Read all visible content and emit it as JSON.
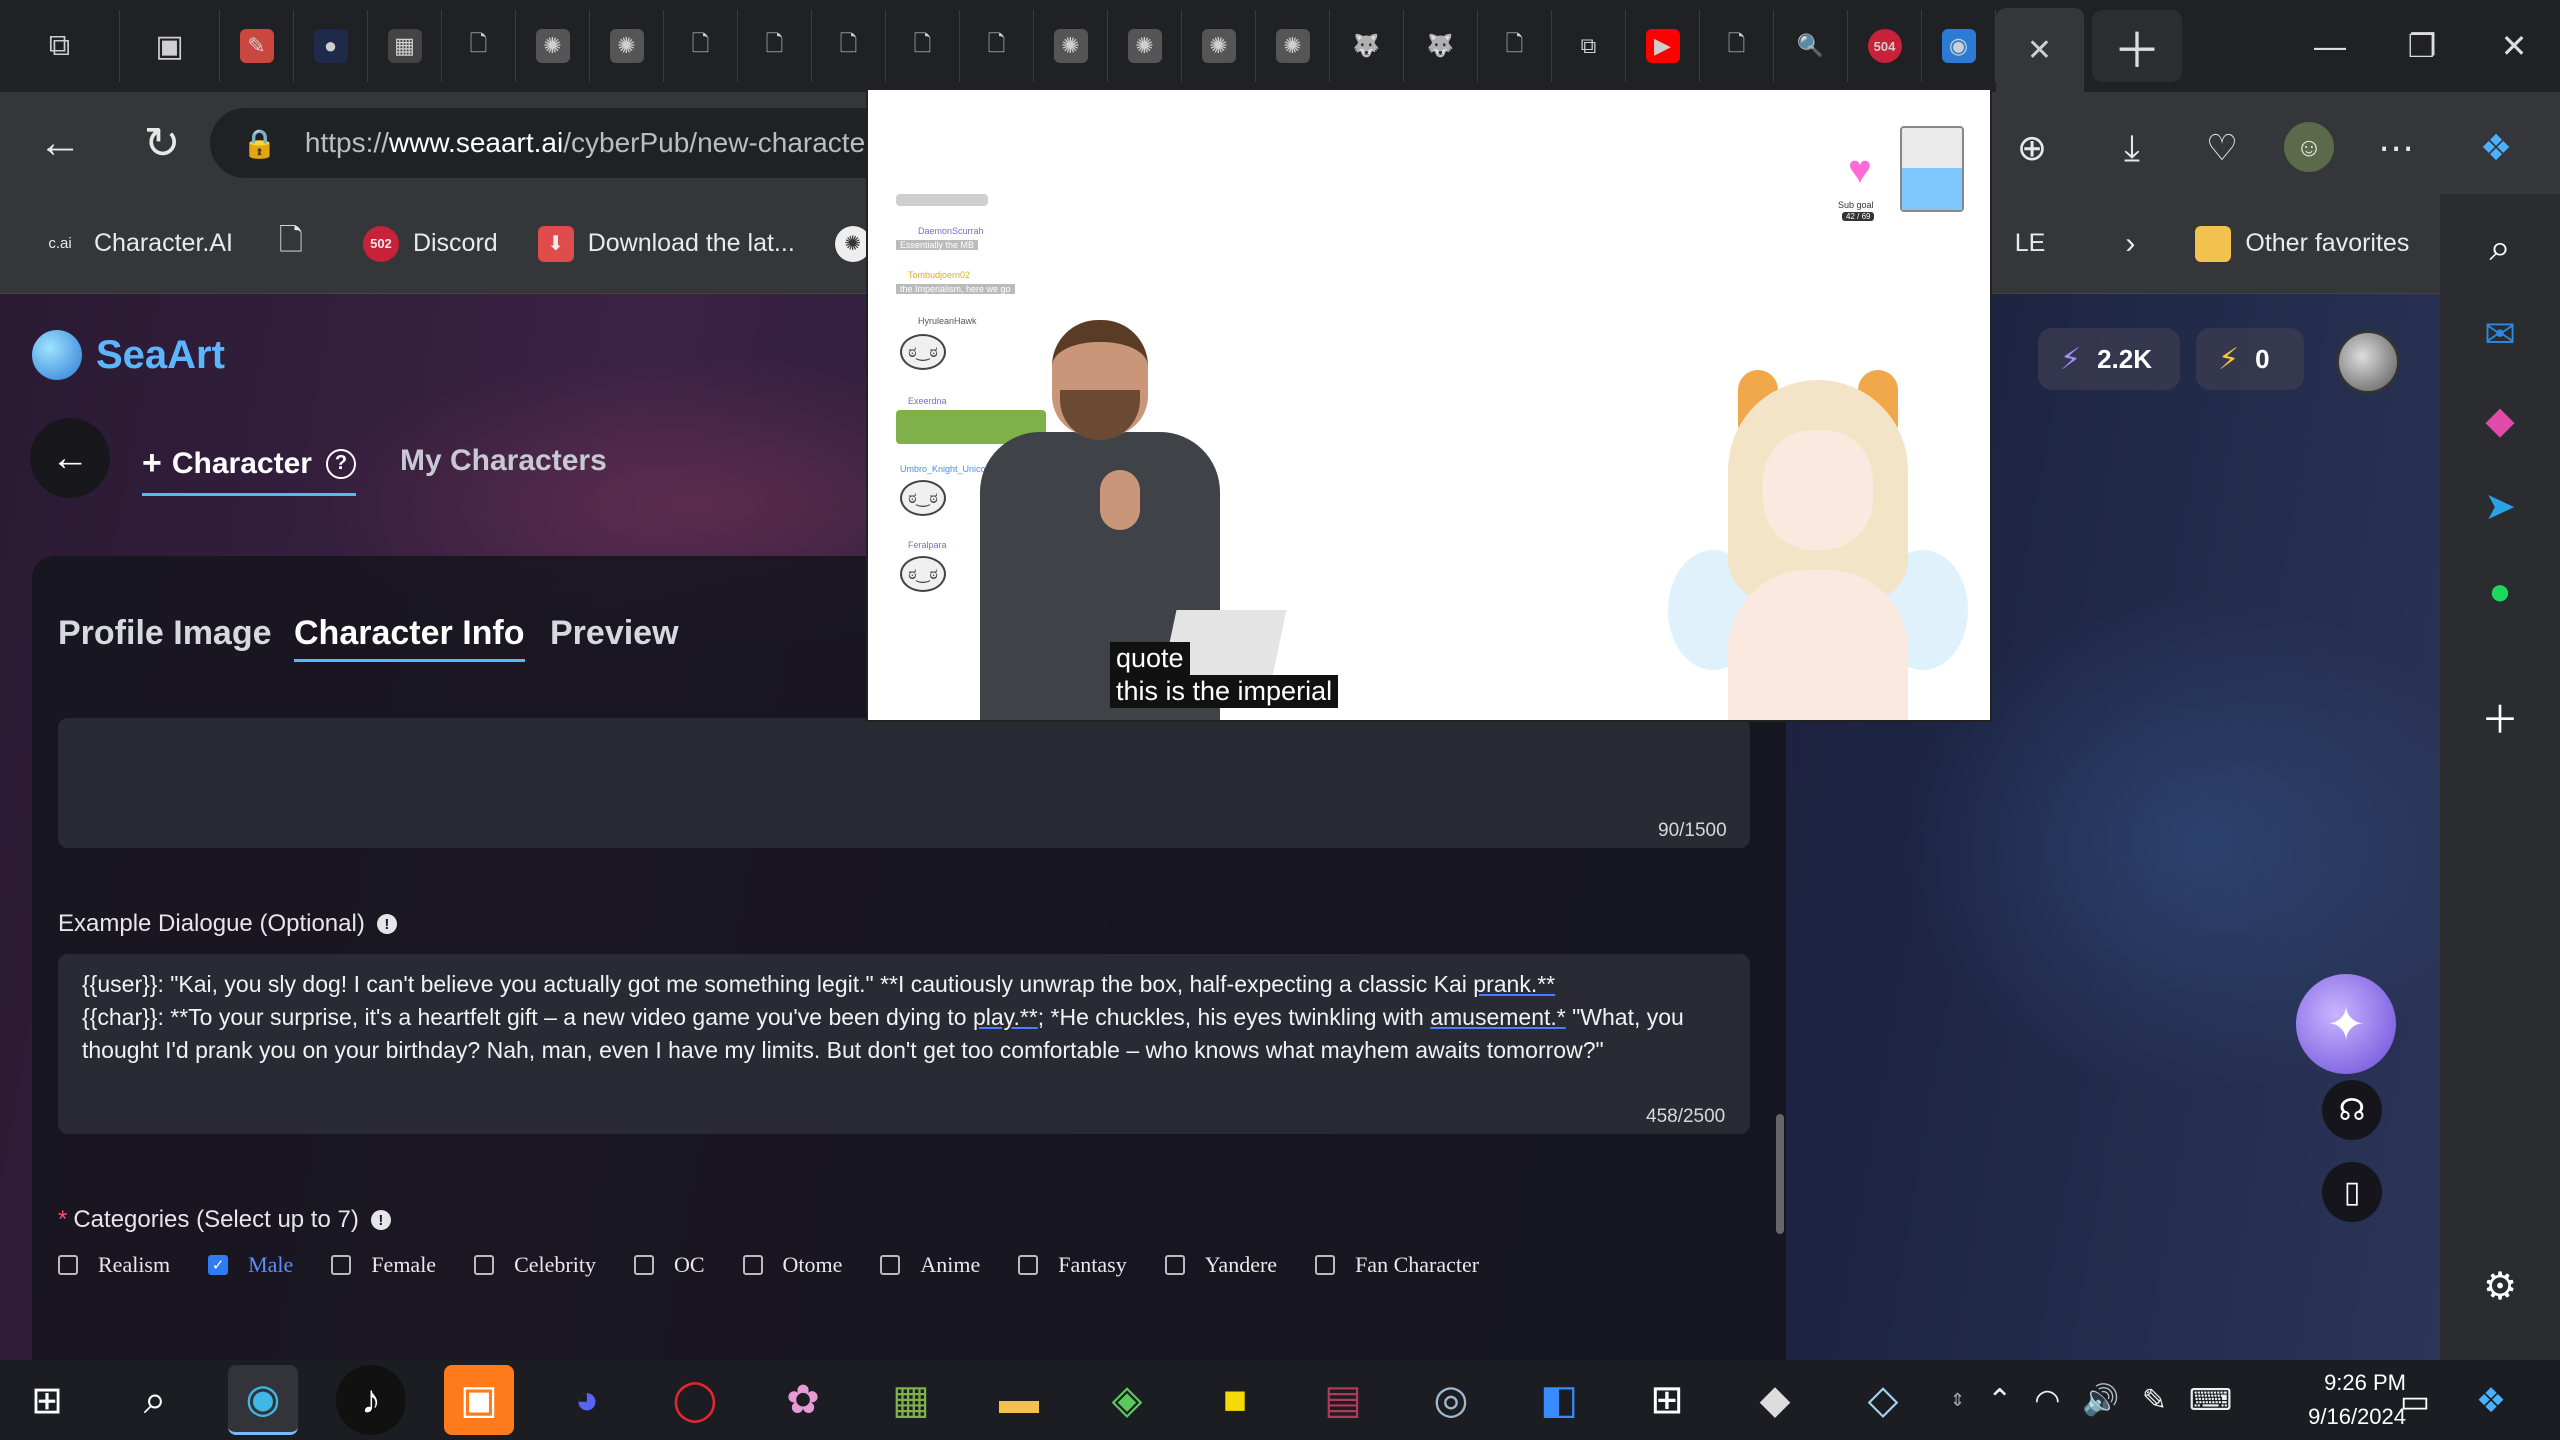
{
  "browser": {
    "url_prefix": "https://",
    "url_domain": "www.seaart.ai",
    "url_path": "/cyberPub/new-characte",
    "tabs": [
      {
        "icon": "edit-icon",
        "color": "#c9473f",
        "glyph": "✎"
      },
      {
        "icon": "circle-icon",
        "color": "#1f2a4a",
        "glyph": "●"
      },
      {
        "icon": "grid-icon",
        "color": "#444",
        "glyph": "▦"
      },
      {
        "icon": "page-icon",
        "color": "transparent",
        "glyph": "🗋"
      },
      {
        "icon": "openai-icon",
        "color": "#555",
        "glyph": "✺"
      },
      {
        "icon": "openai-icon",
        "color": "#555",
        "glyph": "✺"
      },
      {
        "icon": "page-icon",
        "color": "transparent",
        "glyph": "🗋"
      },
      {
        "icon": "page-icon",
        "color": "transparent",
        "glyph": "🗋"
      },
      {
        "icon": "page-icon",
        "color": "transparent",
        "glyph": "🗋"
      },
      {
        "icon": "page-icon",
        "color": "transparent",
        "glyph": "🗋"
      },
      {
        "icon": "page-icon",
        "color": "transparent",
        "glyph": "🗋"
      },
      {
        "icon": "openai-icon",
        "color": "#555",
        "glyph": "✺"
      },
      {
        "icon": "openai-icon",
        "color": "#555",
        "glyph": "✺"
      },
      {
        "icon": "openai-icon",
        "color": "#555",
        "glyph": "✺"
      },
      {
        "icon": "openai-icon",
        "color": "#555",
        "glyph": "✺"
      },
      {
        "icon": "wolf-icon",
        "color": "transparent",
        "glyph": "🐺"
      },
      {
        "icon": "wolf-icon",
        "color": "transparent",
        "glyph": "🐺"
      },
      {
        "icon": "page-icon",
        "color": "transparent",
        "glyph": "🗋"
      },
      {
        "icon": "picture-in-picture-icon",
        "color": "transparent",
        "glyph": "⧉"
      },
      {
        "icon": "youtube-icon",
        "color": "#ff0000",
        "glyph": "▶"
      },
      {
        "icon": "page-icon",
        "color": "transparent",
        "glyph": "🗋"
      },
      {
        "icon": "search-icon",
        "color": "transparent",
        "glyph": "🔍"
      },
      {
        "icon": "error-504-icon",
        "color": "#c8213a",
        "glyph": "504"
      },
      {
        "icon": "seaart-icon",
        "color": "#2b7bd6",
        "glyph": "◉"
      }
    ],
    "error_badge": "504"
  },
  "favorites": {
    "items": [
      {
        "icon": "characterai-icon",
        "badge": "c.ai",
        "label": "Character.AI"
      },
      {
        "icon": "page-icon",
        "badge": "🗋",
        "label": ""
      },
      {
        "icon": "discord-icon",
        "badge": "502",
        "label": "Discord"
      },
      {
        "icon": "download-icon",
        "badge": "⬇",
        "label": "Download the lat..."
      }
    ],
    "overflow_partial": "LE",
    "other": "Other favorites"
  },
  "seaart": {
    "brand": "SeaArt",
    "credits": "2.2K",
    "energy": "0",
    "tab_character": "Character",
    "tab_my": "My Characters",
    "steps": [
      "Profile Image",
      "Character Info",
      "Preview"
    ],
    "top_counter": "90/1500",
    "example_label": "Example Dialogue (Optional)",
    "example_text": {
      "p1": "{{user}}: \"Kai, you sly dog! I can't believe you actually got me something legit.\" **I cautiously unwrap the box, half-expecting a classic Kai ",
      "u1": "prank.**",
      "p2": "{{char}}: **To your surprise, it's a heartfelt gift – a new video game you've been dying to ",
      "u2": "play.**",
      "p3": "; *He chuckles, his eyes twinkling with ",
      "u3": "amusement.*",
      "p4": " \"What, you thought I'd prank you on your birthday? Nah, man, even I have my limits. But don't get too comfortable – who knows what mayhem awaits tomorrow?\""
    },
    "example_counter": "458/2500",
    "categories_label": "Categories (Select up to 7)",
    "categories": [
      {
        "label": "Realism",
        "checked": false
      },
      {
        "label": "Male",
        "checked": true
      },
      {
        "label": "Female",
        "checked": false
      },
      {
        "label": "Celebrity",
        "checked": false
      },
      {
        "label": "OC",
        "checked": false
      },
      {
        "label": "Otome",
        "checked": false
      },
      {
        "label": "Anime",
        "checked": false
      },
      {
        "label": "Fantasy",
        "checked": false
      },
      {
        "label": "Yandere",
        "checked": false
      },
      {
        "label": "Fan Character",
        "checked": false
      }
    ],
    "accent": "#5ab6ff"
  },
  "pip": {
    "subtitle_line1": "quote",
    "subtitle_line2": "this is the imperial",
    "chat_names": [
      "DaemonScurrah",
      "Tombudjoern02",
      "HyruleanHawk",
      "Exeerdna",
      "Umbro_Knight_Unicorn",
      "Feralpara"
    ],
    "chat_msgs": [
      "Essentially the MB",
      "the Imperialism, here we go"
    ],
    "goal_label": "Sub goal",
    "goal_count": "42 / 69"
  },
  "clock": {
    "time": "9:26 PM",
    "date": "9/16/2024"
  }
}
